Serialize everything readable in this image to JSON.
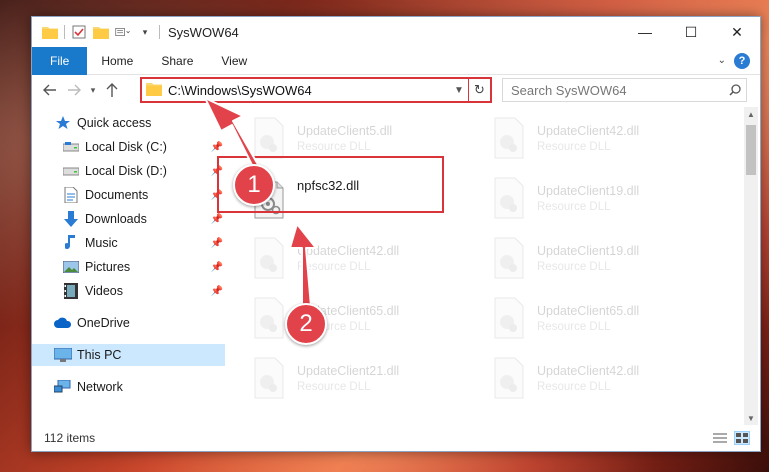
{
  "window": {
    "title": "SysWOW64",
    "minimize": "—",
    "maximize": "☐",
    "close": "✕"
  },
  "ribbon": {
    "tabs": [
      "File",
      "Home",
      "Share",
      "View"
    ]
  },
  "address": {
    "path": "C:\\Windows\\SysWOW64",
    "search_placeholder": "Search SysWOW64"
  },
  "sidebar": {
    "items": [
      {
        "label": "Quick access",
        "icon": "star-icon",
        "pinned": false
      },
      {
        "label": "Local Disk (C:)",
        "icon": "drive-icon",
        "pinned": true
      },
      {
        "label": "Local Disk (D:)",
        "icon": "drive-icon",
        "pinned": true
      },
      {
        "label": "Documents",
        "icon": "documents-icon",
        "pinned": true
      },
      {
        "label": "Downloads",
        "icon": "download-icon",
        "pinned": true
      },
      {
        "label": "Music",
        "icon": "music-icon",
        "pinned": true
      },
      {
        "label": "Pictures",
        "icon": "pictures-icon",
        "pinned": true
      },
      {
        "label": "Videos",
        "icon": "videos-icon",
        "pinned": true
      },
      {
        "label": "OneDrive",
        "icon": "cloud-icon",
        "pinned": false
      },
      {
        "label": "This PC",
        "icon": "computer-icon",
        "pinned": false
      },
      {
        "label": "Network",
        "icon": "network-icon",
        "pinned": false
      }
    ]
  },
  "files": {
    "left": [
      {
        "name": "UpdateClient5.dll",
        "type": "Resource DLL"
      },
      {
        "name": "npfsc32.dll",
        "type": ""
      },
      {
        "name": "UpdateClient42.dll",
        "type": "Resource DLL"
      },
      {
        "name": "UpdateClient65.dll",
        "type": "Resource DLL"
      },
      {
        "name": "UpdateClient21.dll",
        "type": "Resource DLL"
      }
    ],
    "right": [
      {
        "name": "UpdateClient42.dll",
        "type": "Resource DLL"
      },
      {
        "name": "UpdateClient19.dll",
        "type": "Resource DLL"
      },
      {
        "name": "UpdateClient19.dll",
        "type": "Resource DLL"
      },
      {
        "name": "UpdateClient65.dll",
        "type": "Resource DLL"
      },
      {
        "name": "UpdateClient42.dll",
        "type": "Resource DLL"
      }
    ]
  },
  "status": {
    "item_count": "112 items"
  },
  "annotations": {
    "step1": "1",
    "step2": "2",
    "color": "#e2434a"
  }
}
